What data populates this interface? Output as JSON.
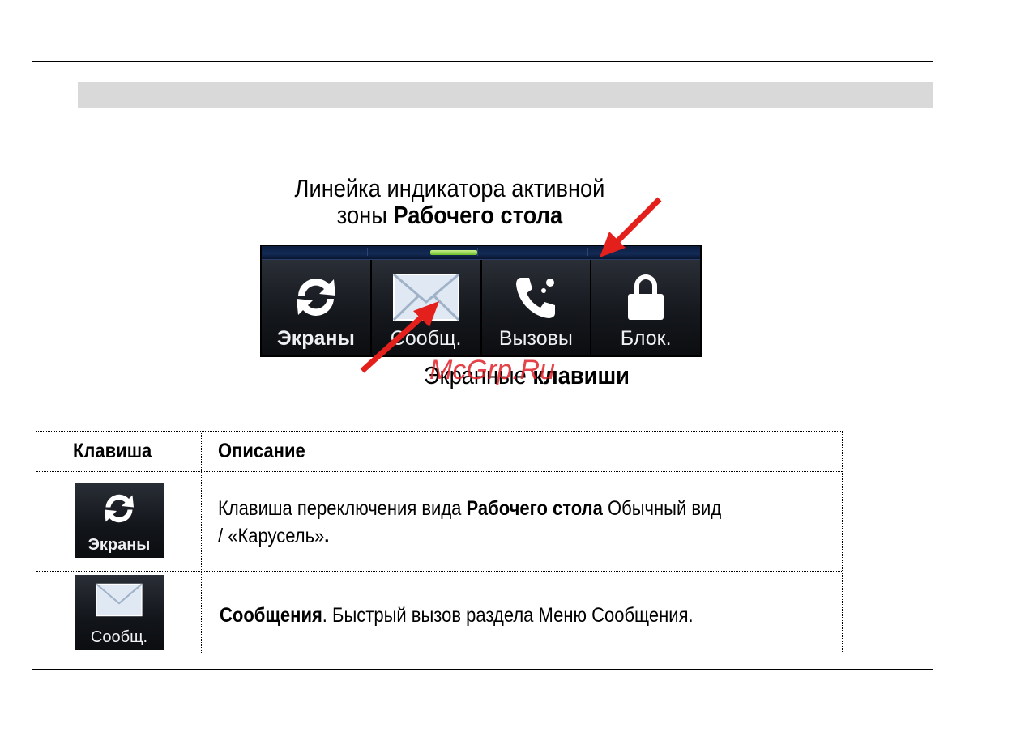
{
  "caption_top": {
    "line1": "Линейка индикатора активной",
    "line2_plain": "зоны ",
    "line2_bold": "Рабочего стола"
  },
  "softkeys": [
    {
      "label": "Экраны",
      "icon": "refresh-icon"
    },
    {
      "label": "Сообщ.",
      "icon": "envelope-icon"
    },
    {
      "label": "Вызовы",
      "icon": "phone-icon"
    },
    {
      "label": "Блок.",
      "icon": "lock-icon"
    }
  ],
  "caption_bottom": {
    "plain": "Экранные ",
    "bold": "клавиши"
  },
  "watermark": "McGrp.Ru",
  "table": {
    "headers": {
      "key": "Клавиша",
      "description": "Описание"
    },
    "rows": [
      {
        "key_label": "Экраны",
        "key_icon": "refresh-icon",
        "desc_line1_plain": "Клавиша переключения вида ",
        "desc_line1_bold": "Рабочего стола",
        "desc_line1_tail": " Обычный вид",
        "desc_line2_plain": "/ «Карусель»",
        "desc_line2_bold": "."
      },
      {
        "key_label": "Сообщ.",
        "key_icon": "envelope-icon",
        "desc_bold": "Сообщения",
        "desc_plain": ". Быстрый вызов раздела Меню Сообщения."
      }
    ]
  },
  "colors": {
    "arrow": "#e4201c",
    "indicator_active": "#8fd14f",
    "band": "#d9d9d9"
  }
}
